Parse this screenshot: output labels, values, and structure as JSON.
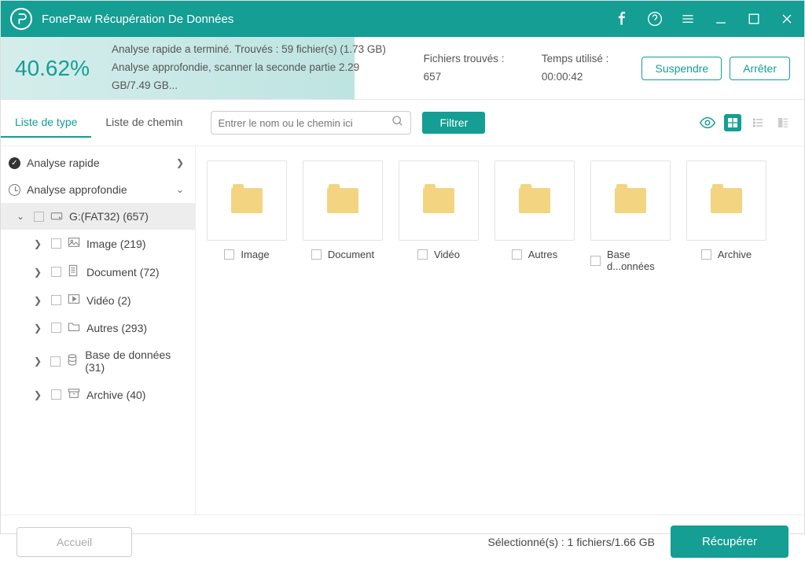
{
  "app": {
    "title": "FonePaw Récupération De Données"
  },
  "progress": {
    "percent": "40.62%",
    "line1": "Analyse rapide a terminé. Trouvés : 59 fichier(s) (1.73 GB)",
    "line2": "Analyse approfondie, scanner la seconde partie 2.29 GB/7.49 GB...",
    "files_found": "Fichiers trouvés : 657",
    "time_used": "Temps utilisé : 00:00:42",
    "suspend": "Suspendre",
    "stop": "Arrêter"
  },
  "tabs": {
    "type": "Liste de type",
    "path": "Liste de chemin"
  },
  "search": {
    "placeholder": "Entrer le nom ou le chemin ici"
  },
  "filter": "Filtrer",
  "tree": {
    "quick": "Analyse rapide",
    "deep": "Analyse approfondie",
    "drive": "G:(FAT32) (657)",
    "items": [
      {
        "label": "Image (219)"
      },
      {
        "label": "Document (72)"
      },
      {
        "label": "Vidéo (2)"
      },
      {
        "label": "Autres (293)"
      },
      {
        "label": "Base de données (31)"
      },
      {
        "label": "Archive (40)"
      }
    ]
  },
  "folders": [
    {
      "label": "Image"
    },
    {
      "label": "Document"
    },
    {
      "label": "Vidéo"
    },
    {
      "label": "Autres"
    },
    {
      "label": "Base d...onnées"
    },
    {
      "label": "Archive"
    }
  ],
  "footer": {
    "home": "Accueil",
    "selected": "Sélectionné(s) : 1 fichiers/1.66 GB",
    "recover": "Récupérer"
  }
}
